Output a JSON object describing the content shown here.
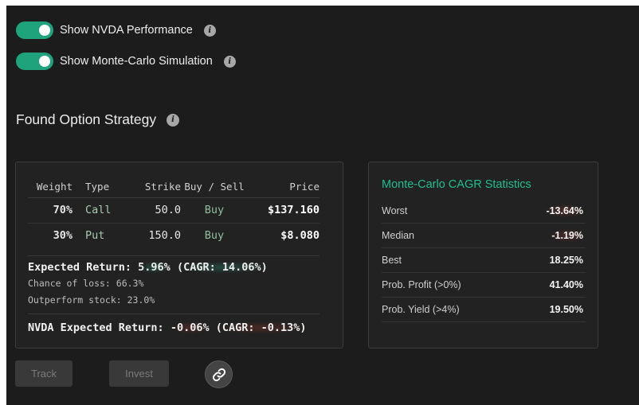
{
  "toggles": [
    {
      "label": "Show NVDA Performance",
      "on": true
    },
    {
      "label": "Show Monte-Carlo Simulation",
      "on": true
    }
  ],
  "section_title": "Found Option Strategy",
  "strategy": {
    "headers": {
      "weight": "Weight",
      "type": "Type",
      "strike": "Strike",
      "buy_sell": "Buy / Sell",
      "price": "Price"
    },
    "rows": [
      {
        "weight": "70%",
        "type": "Call",
        "strike": "50.0",
        "buy_sell": "Buy",
        "price": "$137.160"
      },
      {
        "weight": "30%",
        "type": "Put",
        "strike": "150.0",
        "buy_sell": "Buy",
        "price": "$8.080"
      }
    ],
    "expected_prefix": "Expected Return: ",
    "expected_value": "5.96%",
    "expected_cagr": "(CAGR: 14.06%)",
    "chance_of_loss": "Chance of loss: 66.3%",
    "outperform": "Outperform stock: 23.0%",
    "nvda_prefix": "NVDA Expected Return: ",
    "nvda_value": "-0.06%",
    "nvda_cagr": "(CAGR: -0.13%)"
  },
  "monte_carlo": {
    "title": "Monte-Carlo CAGR Statistics",
    "rows": [
      {
        "label": "Worst",
        "value": "-13.64%"
      },
      {
        "label": "Median",
        "value": "-1.19%"
      },
      {
        "label": "Best",
        "value": "18.25%"
      },
      {
        "label": "Prob. Profit (>0%)",
        "value": "41.40%"
      },
      {
        "label": "Prob. Yield (>4%)",
        "value": "19.50%"
      }
    ]
  },
  "buttons": {
    "track": "Track",
    "invest": "Invest"
  },
  "icons": {
    "info": "info-icon",
    "link": "link-icon"
  },
  "colors": {
    "accent": "#1fa37c",
    "mc_title": "#1fbf8f"
  }
}
